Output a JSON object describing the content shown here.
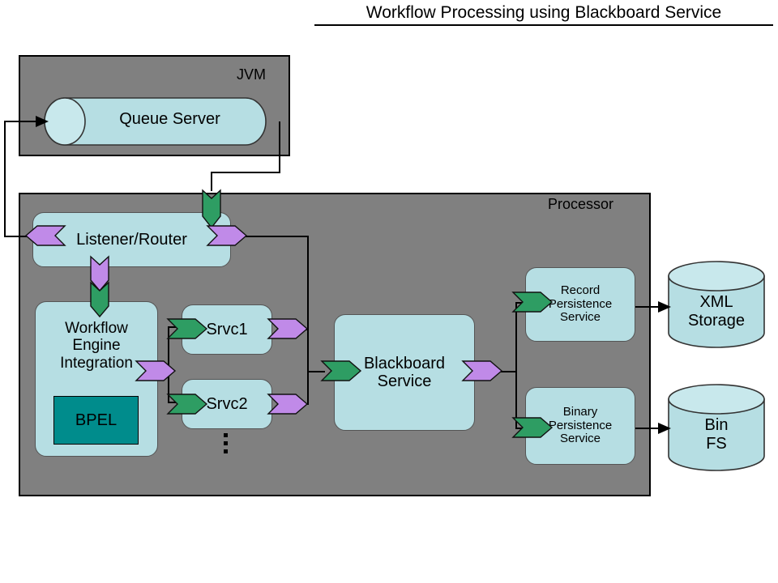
{
  "title": "Workflow Processing using Blackboard Service",
  "containers": [
    {
      "id": "jvm",
      "label": "JVM"
    },
    {
      "id": "processor",
      "label": "Processor"
    }
  ],
  "nodes": {
    "queue_server": "Queue Server",
    "listener_router": "Listener/Router",
    "workflow_engine": "Workflow\nEngine\nIntegration",
    "bpel": "BPEL",
    "srvc1": "Srvc1",
    "srvc2": "Srvc2",
    "more_services": "⋮",
    "blackboard_service": "Blackboard\nService",
    "record_persistence": "Record\nPersistence\nService",
    "binary_persistence": "Binary\nPersistence\nService",
    "xml_storage": "XML\nStorage",
    "bin_fs": "Bin\nFS"
  },
  "colors": {
    "container_fill": "#808080",
    "node_fill": "#b6dee3",
    "bpel_fill": "#008c8c",
    "arrow_green": "#2e9d63",
    "arrow_purple": "#c08ae8",
    "stroke": "#000000",
    "node_stroke": "#555555",
    "page_background": "#ffffff"
  },
  "connectors": [
    {
      "name": "listener-to-queue",
      "from": "Listener/Router",
      "to": "Queue Server",
      "style": "black-arrow"
    },
    {
      "name": "queue-to-listener",
      "from": "Queue Server",
      "to": "Listener/Router",
      "style": "green-chevron"
    },
    {
      "name": "listener-to-workflow",
      "from": "Listener/Router",
      "to": "Workflow Engine Integration",
      "style": "purple-then-green-chevron"
    },
    {
      "name": "workflow-to-services",
      "from": "Workflow Engine Integration",
      "to": "Srvc1, Srvc2",
      "style": "purple-out-green-in"
    },
    {
      "name": "listener-to-blackboard",
      "from": "Listener/Router",
      "to": "Blackboard Service",
      "style": "purple-out-green-in"
    },
    {
      "name": "services-to-blackboard",
      "from": "Srvc1, Srvc2",
      "to": "Blackboard Service",
      "style": "purple-out-green-in"
    },
    {
      "name": "blackboard-to-persistence",
      "from": "Blackboard Service",
      "to": "Record Persistence Service, Binary Persistence Service",
      "style": "purple-out-green-in"
    },
    {
      "name": "record-to-xml-storage",
      "from": "Record Persistence Service",
      "to": "XML Storage",
      "style": "black-arrow"
    },
    {
      "name": "binary-to-bin-fs",
      "from": "Binary Persistence Service",
      "to": "Bin FS",
      "style": "black-arrow"
    }
  ]
}
